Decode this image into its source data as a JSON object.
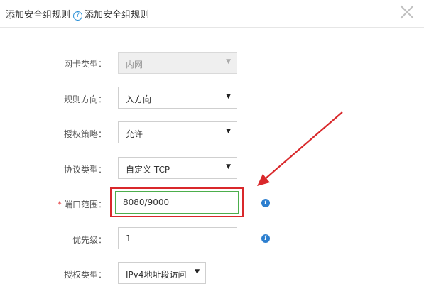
{
  "dialog": {
    "title": "添加安全组规则",
    "help_glyph": "?",
    "subtitle": "添加安全组规则"
  },
  "form": {
    "nic_type": {
      "label": "网卡类型：",
      "value": "内网",
      "disabled": true
    },
    "direction": {
      "label": "规则方向：",
      "value": "入方向"
    },
    "policy": {
      "label": "授权策略：",
      "value": "允许"
    },
    "protocol": {
      "label": "协议类型：",
      "value": "自定义 TCP"
    },
    "port_range": {
      "required_mark": "*",
      "label": "端口范围：",
      "value": "8080/9000"
    },
    "priority": {
      "label": "优先级：",
      "value": "1"
    },
    "auth_type": {
      "label": "授权类型：",
      "value": "IPv4地址段访问"
    }
  },
  "icons": {
    "dropdown": "▼",
    "info": "i"
  },
  "colors": {
    "annotation": "#d9282b",
    "info_icon": "#2d7fcf",
    "help_icon": "#2a8fd6",
    "valid_input_border": "#4cae4c"
  }
}
